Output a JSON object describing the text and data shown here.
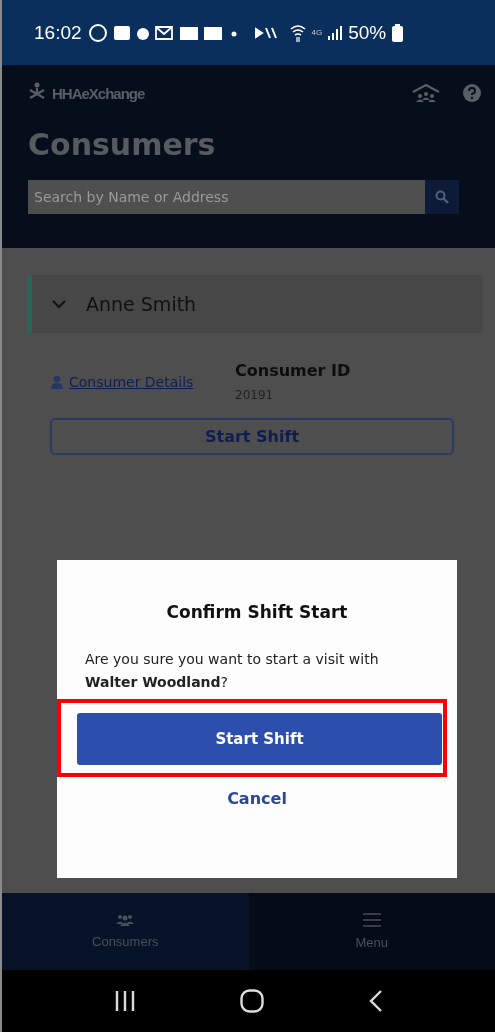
{
  "status_bar": {
    "time": "16:02",
    "network": "4G",
    "battery": "50%"
  },
  "header": {
    "logo": "HHAeXchange",
    "title": "Consumers",
    "search": {
      "placeholder": "Search by Name or Address"
    }
  },
  "consumer": {
    "name": "Anne Smith",
    "expanded": true,
    "details_link": "Consumer Details",
    "id_label": "Consumer ID",
    "id_value": "20191",
    "action": "Start Shift"
  },
  "dialog": {
    "title": "Confirm Shift Start",
    "message": "Are you sure you want to start a visit with **Walter Woodland**?",
    "confirm": {
      "label": "Start Shift",
      "highlighted": true
    },
    "cancel": "Cancel"
  },
  "bottom_nav": [
    {
      "kind": "consumers",
      "label": "Consumers",
      "selected": true
    },
    {
      "kind": "menu",
      "label": "Menu",
      "selected": false
    }
  ]
}
